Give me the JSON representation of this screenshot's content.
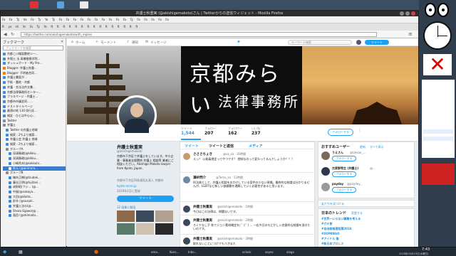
{
  "window": {
    "title": "弁護士秋重実 (@akishigemakoto)さん | Twitterからの送信ウィジェット - Mozilla Firefox",
    "url": "https://twitter.com/akishigemakoto/with_replies"
  },
  "bookmarks_toolbar": [
    "Fa",
    "Fa",
    "Ty",
    "Ve",
    "Fa",
    "Ty",
    "Yo",
    "Ty",
    "Fa",
    "Fa",
    "Fa",
    "Fa",
    "Fa",
    "Fa",
    "Fa",
    "Fa",
    "Fa",
    "Fa",
    "Ty",
    "Fa",
    "Fa",
    "Fa",
    "Fa",
    "Fa"
  ],
  "tabs": [
    "ft",
    "ya",
    "Hi",
    "Ye",
    "Fa",
    "Ty",
    "Ye",
    "ft",
    "ft",
    "ft",
    "ft",
    "ft",
    "ft",
    "ft",
    "ft",
    "ft",
    "ft",
    "ft",
    "ft",
    "ft",
    "ft",
    "ft"
  ],
  "sidebar": {
    "title": "ブックマーク",
    "search_placeholder": "ブックマークを検索",
    "items": [
      {
        "label": "京都こ川場面敷地ツー...",
        "selected": false
      },
      {
        "label": "弁理士 法 高橋推雑学院...",
        "selected": false
      },
      {
        "label": "ダッシュボード - My Pro...",
        "selected": false
      },
      {
        "label": "Blogger: 弁護士秋重...",
        "selected": false
      },
      {
        "label": "Blogger: 不明者合同...",
        "selected": false
      },
      {
        "label": "弁護士書面が...",
        "selected": false
      },
      {
        "label": "手紙 - 農地 - 京都",
        "selected": false
      },
      {
        "label": "弁護 - 合法法件文書...",
        "selected": false
      },
      {
        "label": "京都法律事務所センター...",
        "selected": false
      },
      {
        "label": "ブラスページ - 弁護士...",
        "selected": false
      },
      {
        "label": "京都市市議会同... ...",
        "selected": false
      },
      {
        "label": "テストタイルページ",
        "selected": false
      },
      {
        "label": "最適の地 130 同行氏...",
        "selected": false
      },
      {
        "label": "検証 - ひとは中心心...",
        "selected": false
      },
      {
        "label": "Twitter",
        "selected": false
      },
      {
        "label": "弁護士",
        "selected": false
      },
      {
        "label": "Twitter の弁護士地域",
        "selected": false
      },
      {
        "label": "検索 - 2ちより検索...",
        "selected": false
      },
      {
        "label": "弁護士会 弁護士 地域",
        "selected": false
      },
      {
        "label": "検索 - 2ちより検索...",
        "selected": false
      },
      {
        "label": "グループA",
        "selected": false
      },
      {
        "label": "深清勝政(@kikku...",
        "selected": false
      },
      {
        "label": "深清勝政(@kikku...",
        "selected": false
      },
      {
        "label": "小嶋秀夫(@kokkuhi...",
        "selected": false
      },
      {
        "label": "秋元 (@akimura...",
        "selected": true
      },
      {
        "label": "グループB",
        "selected": false
      },
      {
        "label": "椿木正樹(@tsubak...",
        "selected": false
      },
      {
        "label": "藤谷正明(@fujitani...",
        "selected": false
      },
      {
        "label": "成財昭(フジ... (@...",
        "selected": false
      },
      {
        "label": "中屋(@nakaya...",
        "selected": false
      },
      {
        "label": "大田(@kkota...",
        "selected": false
      },
      {
        "label": "鈴木 (@suzuki..",
        "selected": false
      },
      {
        "label": "弁護士法の(@...",
        "selected": false
      },
      {
        "label": "Shoko Egawa(@...",
        "selected": false
      },
      {
        "label": "島田 (@shimada...",
        "selected": false
      }
    ]
  },
  "twitter_nav": {
    "home": "ホーム",
    "moments": "モーメント",
    "notifications": "通知",
    "messages": "メッセージ",
    "search_placeholder": "キーワード検索",
    "tweet_button": "ツイート"
  },
  "banner": {
    "title_line1": "京都みらい",
    "title_line2": "法律事務所"
  },
  "profile_stats": [
    {
      "label": "ツイート",
      "value": "1,544"
    },
    {
      "label": "フォロー",
      "value": "207"
    },
    {
      "label": "フォロワー",
      "value": "162"
    },
    {
      "label": "いいね",
      "value": "237"
    }
  ],
  "follow_button": "フォローする",
  "profile": {
    "name": "弁護士秋重実",
    "handle": "@akishigemakoto",
    "bio": "京都市下京区で弁護士をしています。中小企業・事業者支援関係 弁護士 相談等 業者にご相談ください。Akishige Makoto lawyer from Kyoto, Japan.",
    "location": "京都市下京区四条通烏丸東入 京都府",
    "website": "kyoto-mirai.jp",
    "joined": "2016年2月に登録",
    "tweet_button": "ツイート",
    "photos_label": "32 画像と動画"
  },
  "timeline_tabs": [
    "ツイート",
    "ツイートと返信",
    "メディア"
  ],
  "tweets": [
    {
      "name": "さささちょき",
      "handle": "@sa_sa · 16時間",
      "text": "えっ？ 公務員規定ってやつです？ 禁制なのって変わってるんでしょうか？？？"
    },
    {
      "name": "凜紗閃介",
      "handle": "@Tomo_kz · 12時間",
      "text": "刑法典として、弁護士相談をおかけしている案件の少ない現場。最終的な結論は分かりませんが、LGBTなど新しい価値観を理解していく必要性があると思います。"
    },
    {
      "name": "弁護士秋重実",
      "handle": "@akishigemakoto · 1時間",
      "text": "今日はこの法律は、問題ないです。"
    },
    {
      "name": "弁護士秋重実",
      "handle": "@akishigemakoto · 2時間",
      "text": "ろくでなし子 秋でジョン素材確定を(ﾟﾟｺﾟﾟ) … 一応今日のもどかしい合意的な結論を頂きたいのです。"
    },
    {
      "name": "弁護士秋重実",
      "handle": "@akishigemakoto · 3時間",
      "text": "取れないことにつけでもうがまた"
    }
  ],
  "who_to_follow": {
    "title": "おすすめユーザー",
    "refresh": "更新",
    "all": "すべて表示",
    "users": [
      {
        "name": "うえさん",
        "handle": "@Uesan_...",
        "button": "フォローする"
      },
      {
        "name": "古家野秀生 (弁護士)",
        "handle": "@...",
        "button": "フォローする"
      },
      {
        "name": "payday",
        "handle": "@payday_",
        "button": "フォローする"
      }
    ],
    "find_friends": "友だちを見つける"
  },
  "trends": {
    "title": "日本のトレンド",
    "change": "変更する",
    "items": [
      "#世界一いらない職業を考える",
      "#ガキ使",
      "#自由総裁選投票2018",
      "#DOMINGO",
      "#アイドル 猫",
      "#新日本プロレス"
    ]
  },
  "taskbar": {
    "items": [
      "ema...",
      "Kons...",
      "Inbo...",
      "xclock",
      "xeyes",
      "xlogo"
    ],
    "clock_time": "7:43",
    "clock_date": "2018年09月19日(水曜日)"
  },
  "colors": {
    "accent": "#1da1f2",
    "desktop": "#3b4f63",
    "selected": "#3a7dd1"
  }
}
